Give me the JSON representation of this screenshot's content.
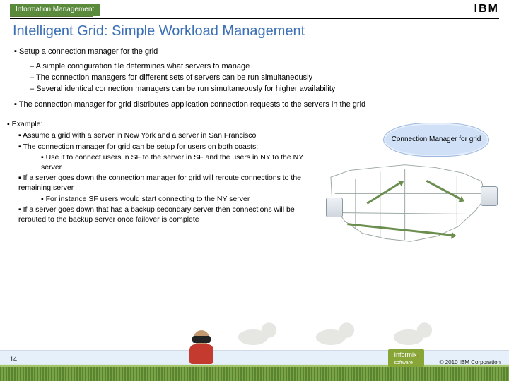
{
  "header": {
    "brand": "Information Management",
    "logo": "IBM"
  },
  "title": "Intelligent Grid: Simple Workload Management",
  "bullets": {
    "b1": "Setup a connection manager for the grid",
    "b1a": "A simple configuration file determines what servers to manage",
    "b1b": "The connection managers for different sets of servers can be run simultaneously",
    "b1c": "Several identical connection managers can be run simultaneously for higher availability",
    "b2": "The connection manager for grid distributes application connection requests to the servers in the grid"
  },
  "example": {
    "head": "Example:",
    "e1": "Assume a grid with a server in New York and a server in San Francisco",
    "e2": "The connection manager for grid can be setup for users on both coasts:",
    "e2a": "Use it to connect users in SF to the server in SF and the users in NY to the NY server",
    "e3": "If a server goes down the connection manager for grid will reroute connections to the remaining server",
    "e3a": "For instance SF users would start connecting to the NY server",
    "e4": "If a server goes down that has a backup secondary server then connections will be rerouted to the backup server once failover is complete"
  },
  "cloud_label": "Connection Manager for grid",
  "footer": {
    "page": "14",
    "product1": "Informix",
    "product2": "software",
    "copyright": "© 2010 IBM Corporation"
  }
}
